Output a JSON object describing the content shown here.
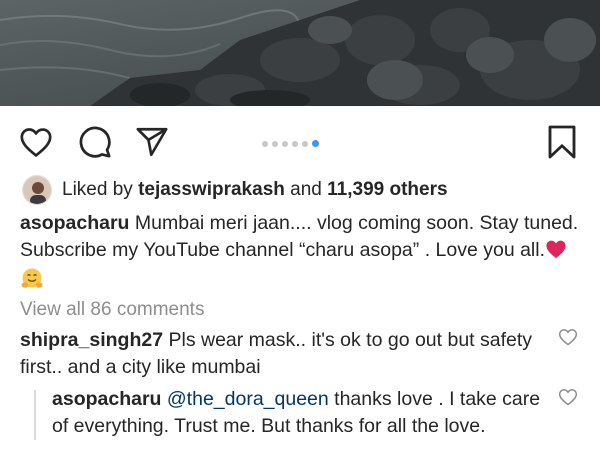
{
  "post": {
    "likes": {
      "prefix": "Liked by",
      "user": "tejasswiprakash",
      "conjunction": "and",
      "others": "11,399 others"
    },
    "caption": {
      "username": "asopacharu",
      "text": "Mumbai meri jaan.... vlog coming soon.  Stay tuned. Subscribe my YouTube channel “charu asopa” . Love you all."
    },
    "carousel": {
      "count": 6,
      "active_index": 5
    },
    "view_all": "View all 86 comments",
    "comments": [
      {
        "username": "shipra_singh27",
        "text": "Pls wear mask.. it's ok to go out but safety first.. and a city like mumbai"
      },
      {
        "username": "asopacharu",
        "mention": "@the_dora_queen",
        "text": "thanks love . I take care of everything. Trust me. But thanks for all the love."
      }
    ]
  },
  "colors": {
    "accent_dot": "#3897f0",
    "muted": "#8e8e8e",
    "mention": "#00376b",
    "heart_emoji": "#e0245e"
  },
  "icons": [
    "heart-icon",
    "comment-icon",
    "share-icon",
    "bookmark-icon",
    "red-heart-emoji",
    "hugging-face-emoji"
  ]
}
